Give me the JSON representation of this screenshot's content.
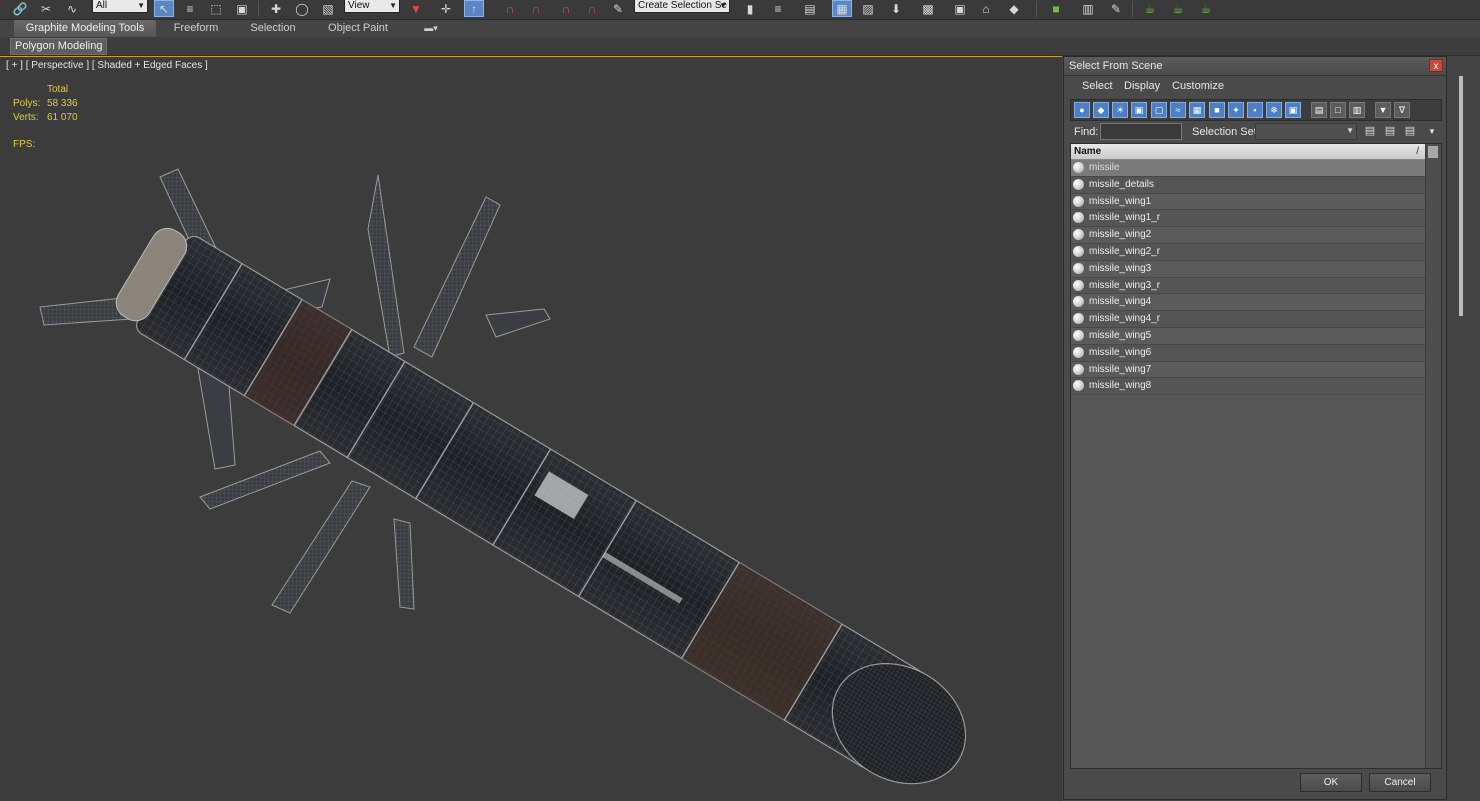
{
  "toolbar": {
    "filter_combo": "All",
    "view_combo": "View",
    "selection_set_combo": "Create Selection Se",
    "icons": [
      "link-icon",
      "unlink-icon",
      "bind-space-warp-icon",
      "select-object-icon",
      "select-by-name-icon",
      "rectangle-region-icon",
      "window-crossing-icon",
      "move-icon",
      "rotate-icon",
      "scale-icon",
      "pivot-icon",
      "select-manipulate-icon",
      "keyboard-shortcut-icon",
      "snap-3d-icon",
      "angle-snap-icon",
      "percent-snap-icon",
      "spinner-snap-icon",
      "edit-named-selection-icon",
      "mirror-icon",
      "align-icon",
      "toggle-scene-explorer-icon",
      "toggle-layer-explorer-icon",
      "graphite-toggle-icon",
      "curve-editor-icon",
      "schematic-view-icon",
      "material-editor-icon",
      "render-setup-icon",
      "rendered-frame-icon",
      "render-icon"
    ]
  },
  "ribbon": {
    "tabs": [
      "Graphite Modeling Tools",
      "Freeform",
      "Selection",
      "Object Paint"
    ],
    "panel": "Polygon Modeling"
  },
  "viewport": {
    "label": "[ + ] [ Perspective ] [ Shaded + Edged Faces ]",
    "stats": {
      "total_label": "Total",
      "polys_label": "Polys:",
      "polys_value": "58 336",
      "verts_label": "Verts:",
      "verts_value": "61 070",
      "fps_label": "FPS:"
    }
  },
  "dialog": {
    "title": "Select From Scene",
    "close_label": "x",
    "menu": [
      "Select",
      "Display",
      "Customize"
    ],
    "find_label": "Find:",
    "find_value": "",
    "selection_set_label": "Selection Set:",
    "list_header": "Name",
    "sort_indicator": "/",
    "objects": [
      "missile",
      "missile_details",
      "missile_wing1",
      "missile_wing1_r",
      "missile_wing2",
      "missile_wing2_r",
      "missile_wing3",
      "missile_wing3_r",
      "missile_wing4",
      "missile_wing4_r",
      "missile_wing5",
      "missile_wing6",
      "missile_wing7",
      "missile_wing8"
    ],
    "selected_index": 0,
    "ok_label": "OK",
    "cancel_label": "Cancel"
  },
  "colors": {
    "stats_text": "#e2cc36",
    "viewport_border": "#c9a12a",
    "toolbar_active": "#5a86c4",
    "snap_magnet": "#e04a4a",
    "render_icons": "#6fc23a"
  }
}
